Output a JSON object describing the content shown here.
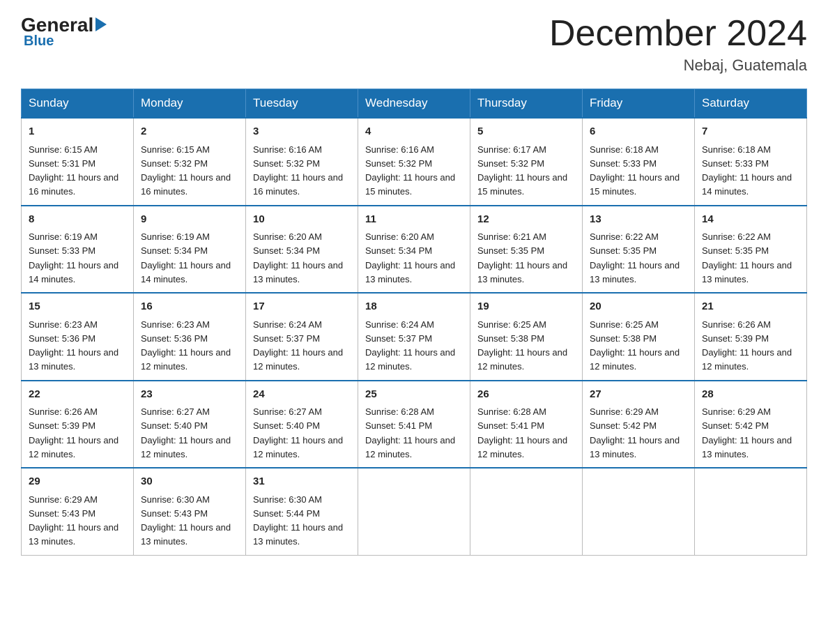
{
  "header": {
    "logo": {
      "text_general": "General",
      "text_blue": "Blue",
      "subtitle": "Blue"
    },
    "title": "December 2024",
    "location": "Nebaj, Guatemala"
  },
  "days_of_week": [
    "Sunday",
    "Monday",
    "Tuesday",
    "Wednesday",
    "Thursday",
    "Friday",
    "Saturday"
  ],
  "weeks": [
    [
      {
        "day": "1",
        "sunrise": "6:15 AM",
        "sunset": "5:31 PM",
        "daylight": "11 hours and 16 minutes."
      },
      {
        "day": "2",
        "sunrise": "6:15 AM",
        "sunset": "5:32 PM",
        "daylight": "11 hours and 16 minutes."
      },
      {
        "day": "3",
        "sunrise": "6:16 AM",
        "sunset": "5:32 PM",
        "daylight": "11 hours and 16 minutes."
      },
      {
        "day": "4",
        "sunrise": "6:16 AM",
        "sunset": "5:32 PM",
        "daylight": "11 hours and 15 minutes."
      },
      {
        "day": "5",
        "sunrise": "6:17 AM",
        "sunset": "5:32 PM",
        "daylight": "11 hours and 15 minutes."
      },
      {
        "day": "6",
        "sunrise": "6:18 AM",
        "sunset": "5:33 PM",
        "daylight": "11 hours and 15 minutes."
      },
      {
        "day": "7",
        "sunrise": "6:18 AM",
        "sunset": "5:33 PM",
        "daylight": "11 hours and 14 minutes."
      }
    ],
    [
      {
        "day": "8",
        "sunrise": "6:19 AM",
        "sunset": "5:33 PM",
        "daylight": "11 hours and 14 minutes."
      },
      {
        "day": "9",
        "sunrise": "6:19 AM",
        "sunset": "5:34 PM",
        "daylight": "11 hours and 14 minutes."
      },
      {
        "day": "10",
        "sunrise": "6:20 AM",
        "sunset": "5:34 PM",
        "daylight": "11 hours and 13 minutes."
      },
      {
        "day": "11",
        "sunrise": "6:20 AM",
        "sunset": "5:34 PM",
        "daylight": "11 hours and 13 minutes."
      },
      {
        "day": "12",
        "sunrise": "6:21 AM",
        "sunset": "5:35 PM",
        "daylight": "11 hours and 13 minutes."
      },
      {
        "day": "13",
        "sunrise": "6:22 AM",
        "sunset": "5:35 PM",
        "daylight": "11 hours and 13 minutes."
      },
      {
        "day": "14",
        "sunrise": "6:22 AM",
        "sunset": "5:35 PM",
        "daylight": "11 hours and 13 minutes."
      }
    ],
    [
      {
        "day": "15",
        "sunrise": "6:23 AM",
        "sunset": "5:36 PM",
        "daylight": "11 hours and 13 minutes."
      },
      {
        "day": "16",
        "sunrise": "6:23 AM",
        "sunset": "5:36 PM",
        "daylight": "11 hours and 12 minutes."
      },
      {
        "day": "17",
        "sunrise": "6:24 AM",
        "sunset": "5:37 PM",
        "daylight": "11 hours and 12 minutes."
      },
      {
        "day": "18",
        "sunrise": "6:24 AM",
        "sunset": "5:37 PM",
        "daylight": "11 hours and 12 minutes."
      },
      {
        "day": "19",
        "sunrise": "6:25 AM",
        "sunset": "5:38 PM",
        "daylight": "11 hours and 12 minutes."
      },
      {
        "day": "20",
        "sunrise": "6:25 AM",
        "sunset": "5:38 PM",
        "daylight": "11 hours and 12 minutes."
      },
      {
        "day": "21",
        "sunrise": "6:26 AM",
        "sunset": "5:39 PM",
        "daylight": "11 hours and 12 minutes."
      }
    ],
    [
      {
        "day": "22",
        "sunrise": "6:26 AM",
        "sunset": "5:39 PM",
        "daylight": "11 hours and 12 minutes."
      },
      {
        "day": "23",
        "sunrise": "6:27 AM",
        "sunset": "5:40 PM",
        "daylight": "11 hours and 12 minutes."
      },
      {
        "day": "24",
        "sunrise": "6:27 AM",
        "sunset": "5:40 PM",
        "daylight": "11 hours and 12 minutes."
      },
      {
        "day": "25",
        "sunrise": "6:28 AM",
        "sunset": "5:41 PM",
        "daylight": "11 hours and 12 minutes."
      },
      {
        "day": "26",
        "sunrise": "6:28 AM",
        "sunset": "5:41 PM",
        "daylight": "11 hours and 12 minutes."
      },
      {
        "day": "27",
        "sunrise": "6:29 AM",
        "sunset": "5:42 PM",
        "daylight": "11 hours and 13 minutes."
      },
      {
        "day": "28",
        "sunrise": "6:29 AM",
        "sunset": "5:42 PM",
        "daylight": "11 hours and 13 minutes."
      }
    ],
    [
      {
        "day": "29",
        "sunrise": "6:29 AM",
        "sunset": "5:43 PM",
        "daylight": "11 hours and 13 minutes."
      },
      {
        "day": "30",
        "sunrise": "6:30 AM",
        "sunset": "5:43 PM",
        "daylight": "11 hours and 13 minutes."
      },
      {
        "day": "31",
        "sunrise": "6:30 AM",
        "sunset": "5:44 PM",
        "daylight": "11 hours and 13 minutes."
      },
      null,
      null,
      null,
      null
    ]
  ]
}
